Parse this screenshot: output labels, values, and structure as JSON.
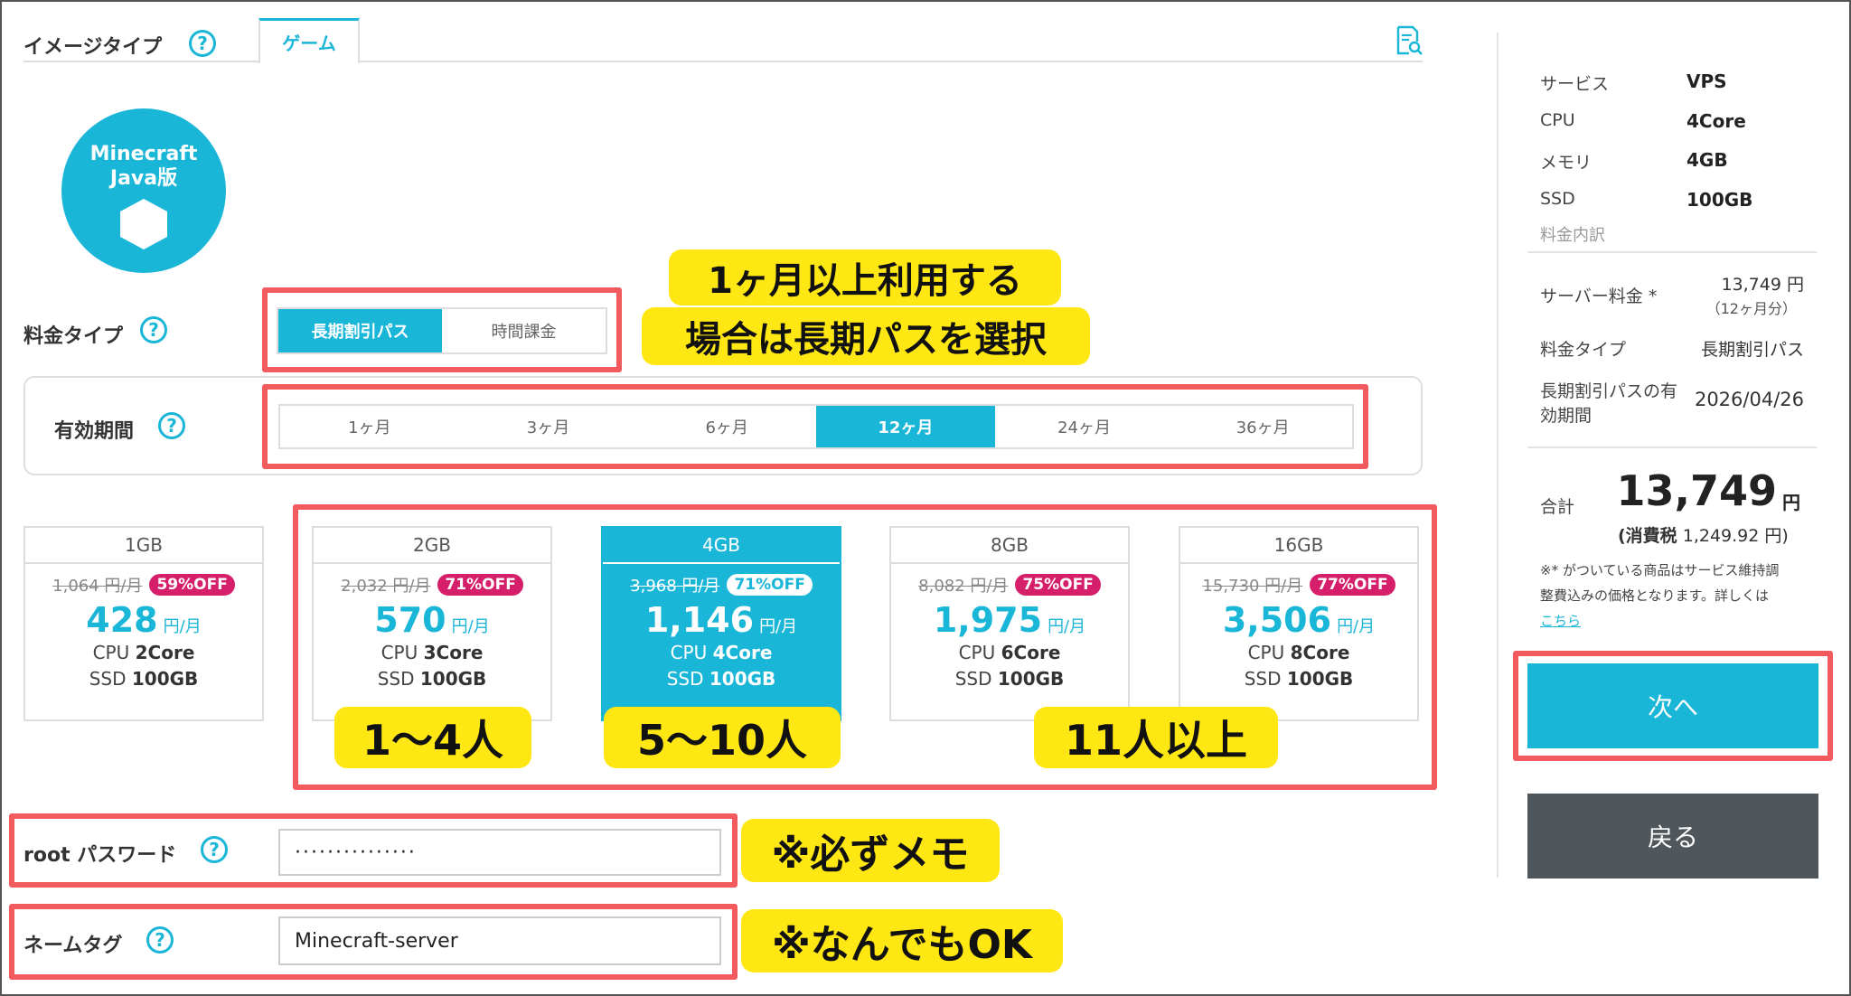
{
  "image_type": {
    "label": "イメージタイプ",
    "tab": "ゲーム"
  },
  "logo": {
    "line1": "Minecraft",
    "line2": "Java版"
  },
  "price_type": {
    "label": "料金タイプ",
    "options": [
      "長期割引パス",
      "時間課金"
    ],
    "selected": "長期割引パス"
  },
  "period": {
    "label": "有効期間",
    "options": [
      "1ヶ月",
      "3ヶ月",
      "6ヶ月",
      "12ヶ月",
      "24ヶ月",
      "36ヶ月"
    ],
    "selected": "12ヶ月"
  },
  "plans": [
    {
      "mem": "1GB",
      "old": "1,064 円/月",
      "off": "59%OFF",
      "price": "428",
      "unit": "円/月",
      "cpu_label": "CPU",
      "cpu": "2Core",
      "ssd_label": "SSD",
      "ssd": "100GB"
    },
    {
      "mem": "2GB",
      "old": "2,032 円/月",
      "off": "71%OFF",
      "price": "570",
      "unit": "円/月",
      "cpu_label": "CPU",
      "cpu": "3Core",
      "ssd_label": "SSD",
      "ssd": "100GB"
    },
    {
      "mem": "4GB",
      "old": "3,968 円/月",
      "off": "71%OFF",
      "price": "1,146",
      "unit": "円/月",
      "cpu_label": "CPU",
      "cpu": "4Core",
      "ssd_label": "SSD",
      "ssd": "100GB"
    },
    {
      "mem": "8GB",
      "old": "8,082 円/月",
      "off": "75%OFF",
      "price": "1,975",
      "unit": "円/月",
      "cpu_label": "CPU",
      "cpu": "6Core",
      "ssd_label": "SSD",
      "ssd": "100GB"
    },
    {
      "mem": "16GB",
      "old": "15,730 円/月",
      "off": "77%OFF",
      "price": "3,506",
      "unit": "円/月",
      "cpu_label": "CPU",
      "cpu": "8Core",
      "ssd_label": "SSD",
      "ssd": "100GB"
    }
  ],
  "root_password": {
    "label": "root パスワード",
    "value": "···············"
  },
  "name_tag": {
    "label": "ネームタグ",
    "value": "Minecraft-server"
  },
  "annotations": {
    "long_term_line1": "1ヶ月以上利用する",
    "long_term_line2": "場合は長期パスを選択",
    "people_1": "1～4人",
    "people_2": "5～10人",
    "people_3": "11人以上",
    "memo": "※必ずメモ",
    "anything_ok": "※なんでもOK"
  },
  "summary": {
    "service_label": "サービス",
    "service": "VPS",
    "cpu_label": "CPU",
    "cpu": "4Core",
    "memory_label": "メモリ",
    "memory": "4GB",
    "ssd_label": "SSD",
    "ssd": "100GB",
    "breakdown_label": "料金内訳",
    "server_fee_label": "サーバー料金 *",
    "server_fee": "13,749 円",
    "server_fee_note": "（12ヶ月分）",
    "price_type_label": "料金タイプ",
    "price_type": "長期割引パス",
    "expiry_label_1": "長期割引パスの有",
    "expiry_label_2": "効期間",
    "expiry": "2026/04/26",
    "total_label": "合計",
    "total": "13,749",
    "total_unit": "円",
    "tax_label": "(消費税",
    "tax": "1,249.92 円)",
    "note_1": "※* がついている商品はサービス維持調",
    "note_2": "整費込みの価格となります。詳しくは",
    "note_link": "こちら",
    "next_button": "次へ",
    "back_button": "戻る"
  },
  "colors": {
    "accent": "#1ab6d8",
    "annotation_red": "#f25a5e",
    "annotation_yellow": "#ffe713",
    "off_badge": "#d61f6b",
    "back_button": "#50575c"
  }
}
